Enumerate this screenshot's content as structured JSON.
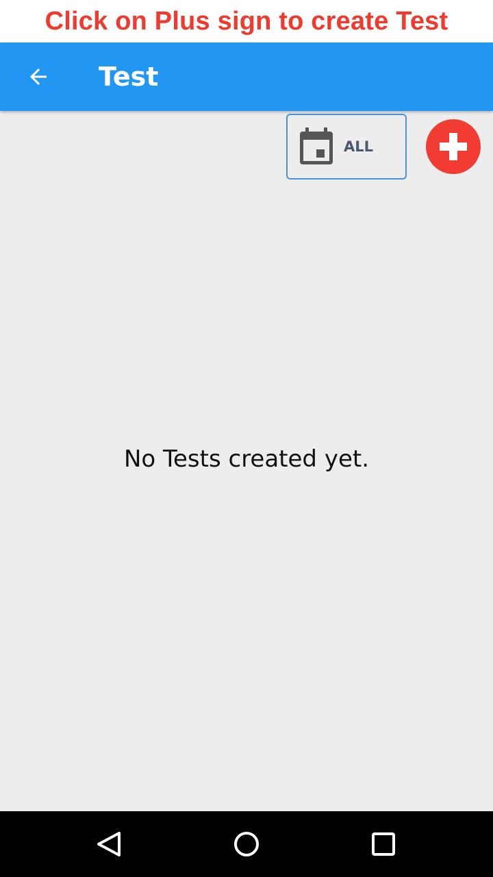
{
  "banner": {
    "text": "Click on Plus sign to create Test"
  },
  "appbar": {
    "title": "Test",
    "back_icon": "arrow-left-icon"
  },
  "filter": {
    "label": "ALL",
    "icon": "calendar-icon"
  },
  "add_button": {
    "icon": "plus-icon",
    "color": "#f23c33"
  },
  "empty_state": {
    "message": "No Tests created yet."
  },
  "navbar": {
    "back_icon": "triangle-back-icon",
    "home_icon": "circle-home-icon",
    "recent_icon": "square-recents-icon"
  },
  "colors": {
    "accent": "#2196f3",
    "banner_text": "#f03a2e",
    "background": "#ededed"
  }
}
